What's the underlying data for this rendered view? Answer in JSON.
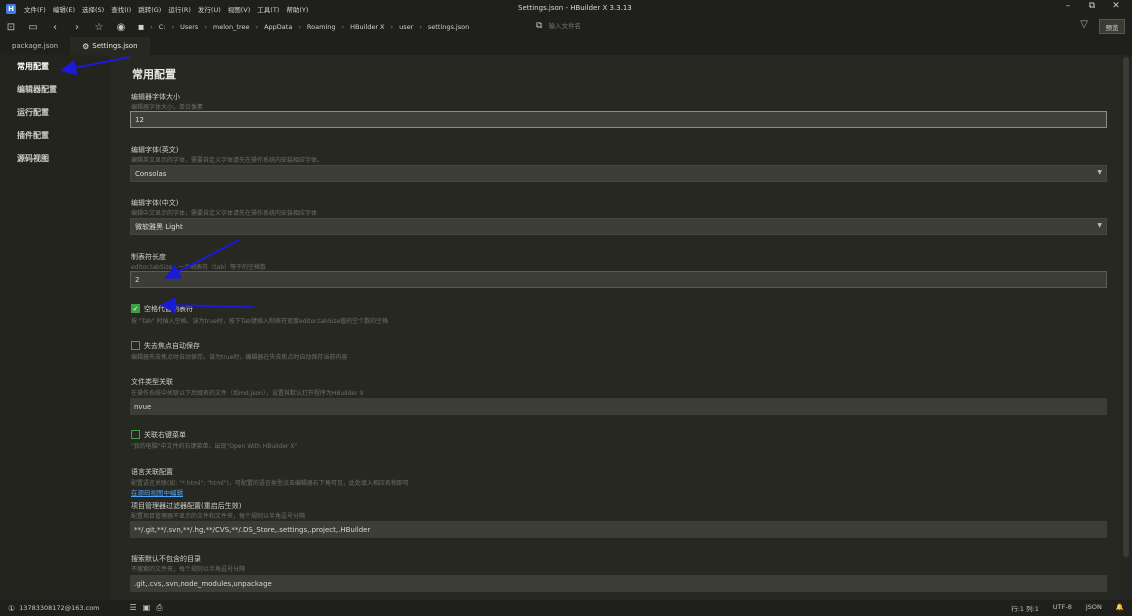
{
  "window": {
    "title": "Settings.json - HBuilder X 3.3.13",
    "menu": [
      "文件(F)",
      "编辑(E)",
      "选择(S)",
      "查找(I)",
      "跳转(G)",
      "运行(R)",
      "发行(U)",
      "视图(V)",
      "工具(T)",
      "帮助(Y)"
    ],
    "controls": {
      "minimize": "–",
      "restore": "⧉",
      "close": "✕"
    }
  },
  "toolbar": {
    "breadcrumb": [
      "C:",
      "Users",
      "melon_tree",
      "AppData",
      "Roaming",
      "HBuilder X",
      "user",
      "settings.json"
    ],
    "search_placeholder": "输入文件名",
    "preview_label": "预览"
  },
  "tabs": [
    {
      "label": "package.json",
      "active": false
    },
    {
      "label": "Settings.json",
      "active": true
    }
  ],
  "sidebar": {
    "items": [
      {
        "label": "常用配置",
        "active": true
      },
      {
        "label": "编辑器配置",
        "active": false
      },
      {
        "label": "运行配置",
        "active": false
      },
      {
        "label": "插件配置",
        "active": false
      },
      {
        "label": "源码视图",
        "active": false
      }
    ]
  },
  "main": {
    "title": "常用配置",
    "font_size": {
      "label": "编辑器字体大小",
      "desc": "编辑器字体大小，单位像素",
      "value": "12"
    },
    "font_en": {
      "label": "编辑字体(英文)",
      "desc": "编辑英文显示的字体，需要自定义字体请先在操作系统内安装相应字体。",
      "value": "Consolas"
    },
    "font_cn": {
      "label": "编辑字体(中文)",
      "desc": "编辑中文显示的字体，需要自定义字体请先在操作系统内安装相应字体",
      "value": "微软雅黑 Light"
    },
    "tab_size": {
      "label": "制表符长度",
      "desc": "editor.tabSize，一个制表符（tab）等于的空格数",
      "value": "2"
    },
    "insert_spaces": {
      "label": "空格代替制表符",
      "desc": "按 \"Tab\" 时插入空格。该为true时，按下Tab键插入制表符宽度editor.tabSize值的空个数的空格",
      "checked": true
    },
    "auto_save": {
      "label": "失去焦点自动保存",
      "desc": "编辑器失去焦点时自动保存。该为true时，编辑器在失去焦点时自动保存当前内容",
      "checked": false
    },
    "file_assoc": {
      "label": "文件类型关联",
      "desc": "在操作系统中关联以下后缀名的文件（如md,json），设置其默认打开程序为HBuilder X",
      "value": "nvue"
    },
    "context_menu": {
      "label": "关联右键菜单",
      "desc": "\"我的电脑\"中文件的右键菜单，出现\"Open With HBuilder X\"",
      "checked": false
    },
    "lang_assoc": {
      "label": "语言关联配置",
      "desc": "配置语言关联(如: \"*.html\": \"html\")，可配置的语言类型点击编辑器右下角可见，此处填入相应名称即可",
      "link": "在源码视图中编辑"
    },
    "project_filter": {
      "label": "项目管理器过滤器配置(重启后生效)",
      "desc": "配置项目管理器不显示的文件和文件夹，每个规则以半角逗号分隔",
      "value": "**/.git,**/.svn,**/.hg,**/CVS,**/.DS_Store,.settings,.project,.HBuilder"
    },
    "search_exclude": {
      "label": "搜索默认不包含的目录",
      "desc": "不搜索的文件夹，每个规则以半角逗号分隔",
      "value": ".git,.cvs,.svn,node_modules,unpackage"
    }
  },
  "statusbar": {
    "account": "13783308172@163.com",
    "position": "行:1  列:1",
    "encoding": "UTF-8",
    "language": "JSON"
  },
  "colors": {
    "accent": "#3d9e47",
    "link": "#4da3ff",
    "annotation": "#1a1adb"
  }
}
